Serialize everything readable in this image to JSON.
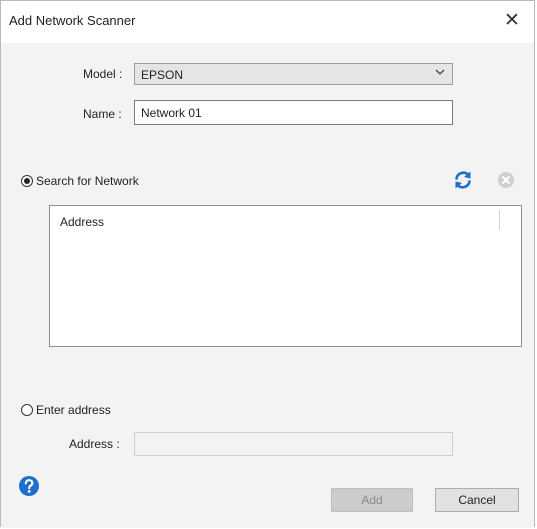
{
  "window": {
    "title": "Add Network Scanner",
    "close_glyph": "✕"
  },
  "form": {
    "model_label": "Model :",
    "model_value": "EPSON",
    "name_label": "Name :",
    "name_value": "Network 01"
  },
  "search": {
    "radio_label": "Search for Network",
    "selected": true,
    "refresh_icon": "refresh-icon",
    "stop_icon": "stop-icon",
    "column_header": "Address"
  },
  "manual": {
    "radio_label": "Enter address",
    "selected": false,
    "address_label": "Address :",
    "address_value": ""
  },
  "footer": {
    "help_icon": "help-icon",
    "add_label": "Add",
    "cancel_label": "Cancel"
  },
  "colors": {
    "accent": "#1e6fc9",
    "disabled_icon": "#c8c8c8"
  }
}
